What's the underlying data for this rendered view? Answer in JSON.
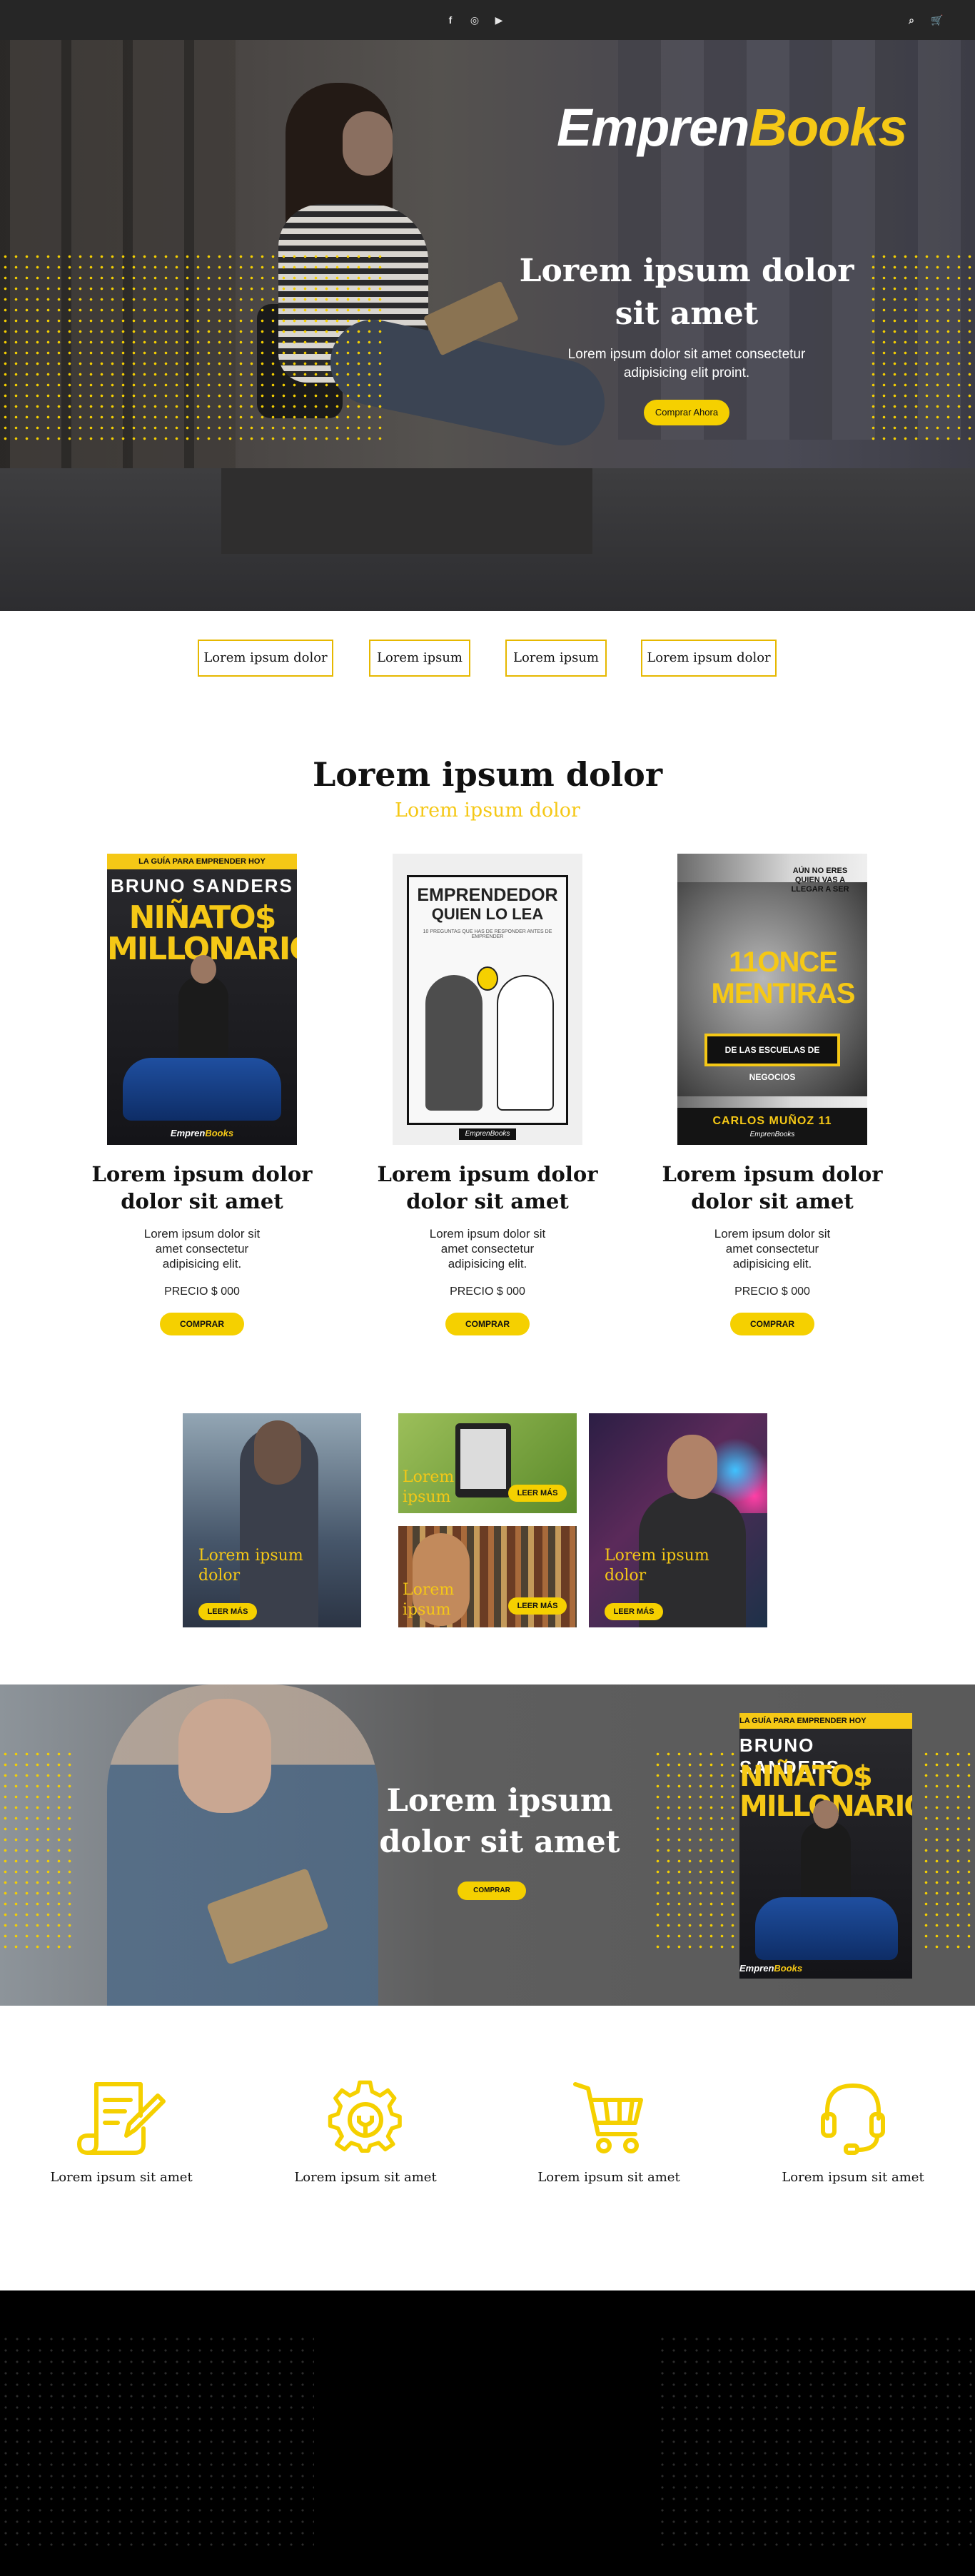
{
  "topbar": {
    "social_icons": [
      "facebook-icon",
      "instagram-icon",
      "youtube-icon"
    ],
    "social_glyphs": [
      "f",
      "◎",
      "▶"
    ],
    "tool_icons": [
      "search-icon",
      "cart-icon"
    ],
    "tool_glyphs": [
      "⌕",
      "🛒"
    ]
  },
  "hero": {
    "logo_part1": "Empren",
    "logo_part2": "Books",
    "title": "Lorem ipsum dolor sit amet",
    "subtitle": "Lorem ipsum dolor sit amet consectetur adipisicing elit proint.",
    "cta_label": "Comprar Ahora"
  },
  "categories": [
    "Lorem ipsum dolor",
    "Lorem ipsum",
    "Lorem ipsum",
    "Lorem ipsum dolor"
  ],
  "products_section": {
    "title": "Lorem ipsum dolor",
    "subtitle": "Lorem ipsum dolor"
  },
  "products": [
    {
      "title": "Lorem ipsum dolor dolor sit amet",
      "description": "Lorem ipsum dolor sit amet consectetur adipisicing elit.",
      "price": "PRECIO $ 000",
      "buy_label": "COMPRAR",
      "cover": {
        "band": "LA GUÍA PARA EMPRENDER HOY",
        "author": "BRUNO SANDERS",
        "title": "NIÑATO$ MILLONARIO$",
        "brand1": "Empren",
        "brand2": "Books"
      }
    },
    {
      "title": "Lorem ipsum dolor dolor sit amet",
      "description": "Lorem ipsum dolor sit amet consectetur adipisicing elit.",
      "price": "PRECIO $ 000",
      "buy_label": "COMPRAR",
      "cover": {
        "title1": "EMPRENDEDOR",
        "title2": "QUIEN LO LEA",
        "tagline": "10 PREGUNTAS QUE HAS DE RESPONDER ANTES DE EMPRENDER",
        "brand": "EmprenBooks"
      }
    },
    {
      "title": "Lorem ipsum dolor dolor sit amet",
      "description": "Lorem ipsum dolor sit amet consectetur adipisicing elit.",
      "price": "PRECIO $ 000",
      "buy_label": "COMPRAR",
      "cover": {
        "question": "AÚN NO ERES QUIEN VAS A LLEGAR A SER",
        "title": "11ONCE MENTIRAS",
        "box": "DE LAS ESCUELAS DE NEGOCIOS",
        "author": "CARLOS MUÑOZ 11",
        "brand": "EmprenBooks"
      }
    }
  ],
  "blog": [
    {
      "label": "Lorem ipsum dolor",
      "more": "LEER MÁS"
    },
    {
      "label": "Lorem ipsum",
      "more": "LEER MÁS"
    },
    {
      "label": "Lorem ipsum",
      "more": "LEER MÁS"
    },
    {
      "label": "Lorem ipsum dolor",
      "more": "LEER MÁS"
    }
  ],
  "promo": {
    "title": "Lorem ipsum dolor sit amet",
    "cta_label": "COMPRAR",
    "cover": {
      "band": "LA GUÍA PARA EMPRENDER HOY",
      "author": "BRUNO SANDERS",
      "title": "NIÑATO$ MILLONARIO$",
      "brand1": "Empren",
      "brand2": "Books"
    }
  },
  "features": [
    {
      "icon": "document-edit-icon",
      "label": "Lorem ipsum sit amet"
    },
    {
      "icon": "gear-icon",
      "label": "Lorem ipsum sit amet"
    },
    {
      "icon": "cart-icon",
      "label": "Lorem ipsum sit amet"
    },
    {
      "icon": "headset-icon",
      "label": "Lorem ipsum sit amet"
    }
  ],
  "colors": {
    "accent": "#f5d000",
    "dark": "#262626",
    "footer": "#000000"
  }
}
